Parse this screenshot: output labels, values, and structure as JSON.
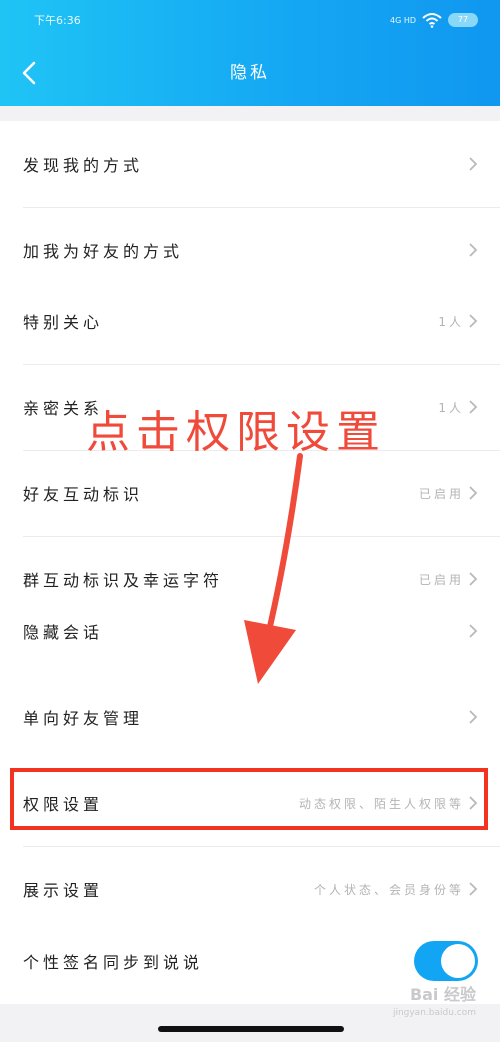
{
  "status_bar": {
    "time": "下午6:36",
    "signal": "4G HD",
    "battery": "77"
  },
  "header": {
    "title": "隐私",
    "back_icon": "back-arrow-icon"
  },
  "colors": {
    "header_gradient_start": "#1fc4f5",
    "header_gradient_end": "#1097f0",
    "toggle_on": "#11a5f3",
    "annotation_red": "#f04a3a"
  },
  "sections": [
    {
      "rows": [
        {
          "label": "发现我的方式",
          "value": ""
        },
        {
          "label": "加我为好友的方式",
          "value": ""
        }
      ]
    },
    {
      "rows": [
        {
          "label": "特别关心",
          "value": "1人"
        },
        {
          "label": "亲密关系",
          "value": "1人"
        },
        {
          "label": "好友互动标识",
          "value": "已启用"
        },
        {
          "label": "群互动标识及幸运字符",
          "value": "已启用"
        }
      ]
    },
    {
      "rows": [
        {
          "label": "隐藏会话",
          "value": ""
        }
      ]
    },
    {
      "rows": [
        {
          "label": "单向好友管理",
          "value": ""
        }
      ]
    },
    {
      "rows": [
        {
          "label": "权限设置",
          "value": "动态权限、陌生人权限等"
        },
        {
          "label": "展示设置",
          "value": "个人状态、会员身份等"
        }
      ]
    },
    {
      "rows": [
        {
          "label": "个性签名同步到说说",
          "toggle": "on"
        }
      ]
    }
  ],
  "annotation": {
    "text": "点击权限设置"
  },
  "watermark": {
    "brand": "Bai 经验",
    "site": "jingyan.baidu.com"
  }
}
